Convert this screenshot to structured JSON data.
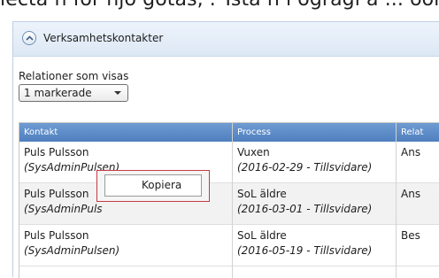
{
  "top_text": "lecta n för njo gotas, . Tsta n i ogragi a ... oordina",
  "panel": {
    "title": "Verksamhetskontakter"
  },
  "filter": {
    "label": "Relationer som visas",
    "selected": "1 markerade"
  },
  "table": {
    "columns": [
      "Kontakt",
      "Process",
      "Relat"
    ],
    "rows": [
      {
        "name": "Puls Pulsson",
        "user": "(SysAdminPulsen)",
        "process": "Vuxen",
        "period": "(2016-02-29 - Tillsvidare)",
        "relation": "Ans"
      },
      {
        "name": "Puls Pulsson",
        "user": "(SysAdminPuls",
        "process": "SoL äldre",
        "period": "(2016-03-01 - Tillsvidare)",
        "relation": "Ans"
      },
      {
        "name": "Puls Pulsson",
        "user": "(SysAdminPulsen)",
        "process": "SoL äldre",
        "period": "(2016-05-19 - Tillsvidare)",
        "relation": "Bes"
      }
    ]
  },
  "context_menu": {
    "items": [
      "Kopiera"
    ]
  }
}
